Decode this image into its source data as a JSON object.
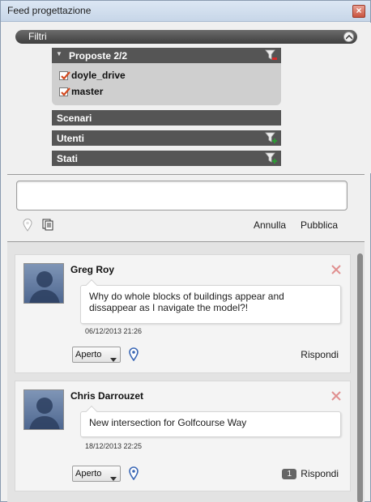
{
  "window": {
    "title": "Feed progettazione"
  },
  "filters": {
    "label": "Filtri",
    "groups": [
      {
        "label": "Proposte 2/2",
        "items": [
          {
            "label": "doyle_drive",
            "checked": true
          },
          {
            "label": "master",
            "checked": true
          }
        ]
      },
      {
        "label": "Scenari"
      },
      {
        "label": "Utenti"
      },
      {
        "label": "Stati"
      }
    ]
  },
  "composer": {
    "input_value": "",
    "cancel_label": "Annulla",
    "publish_label": "Pubblica"
  },
  "feed": {
    "posts": [
      {
        "author": "Greg Roy",
        "message": "Why do whole blocks of buildings appear and dissappear as I navigate the model?!",
        "timestamp": "06/12/2013 21:26",
        "status": "Aperto",
        "reply_label": "Rispondi",
        "reply_count": ""
      },
      {
        "author": "Chris Darrouzet",
        "message": "New intersection for Golfcourse Way",
        "timestamp": "18/12/2013 22:25",
        "status": "Aperto",
        "reply_label": "Rispondi",
        "reply_count": "1"
      }
    ]
  },
  "colors": {
    "group_header": "#555555",
    "accent_blue": "#3a67b5",
    "filter_remove_red": "#d42a2a",
    "filter_add_green": "#2e9a35"
  }
}
